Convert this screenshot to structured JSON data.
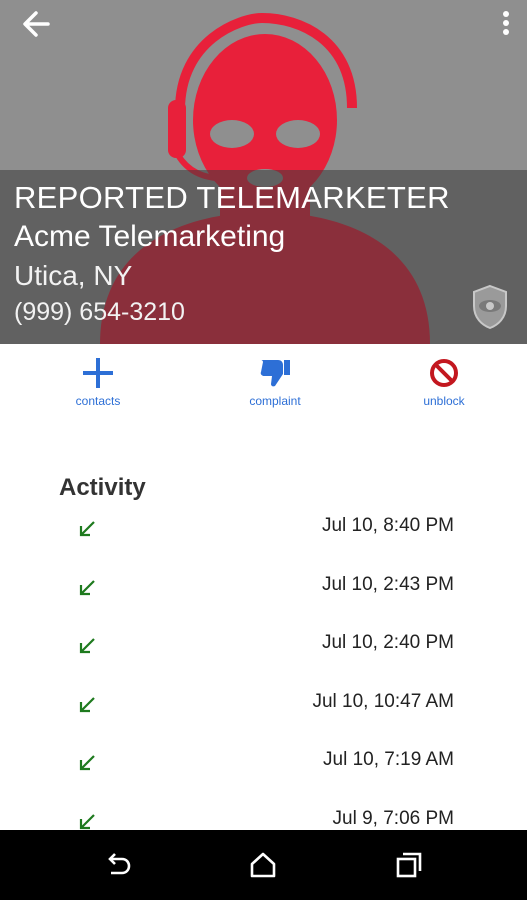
{
  "header": {
    "title": "REPORTED TELEMARKETER",
    "company": "Acme Telemarketing",
    "location": "Utica, NY",
    "phone": "(999) 654-3210"
  },
  "actions": [
    {
      "label": "contacts",
      "icon": "plus-icon"
    },
    {
      "label": "complaint",
      "icon": "thumbs-down-icon"
    },
    {
      "label": "unblock",
      "icon": "block-icon"
    }
  ],
  "activity": {
    "heading": "Activity",
    "items": [
      {
        "time": "Jul 10, 8:40 PM",
        "icon": "incoming-call-icon"
      },
      {
        "time": "Jul 10, 2:43 PM",
        "icon": "incoming-call-icon"
      },
      {
        "time": "Jul 10, 2:40 PM",
        "icon": "incoming-call-icon"
      },
      {
        "time": "Jul 10, 10:47 AM",
        "icon": "incoming-call-icon"
      },
      {
        "time": "Jul 10, 7:19 AM",
        "icon": "incoming-call-icon"
      },
      {
        "time": "Jul 9, 7:06 PM",
        "icon": "incoming-call-icon"
      }
    ]
  },
  "colors": {
    "accent_red": "#e8203a",
    "blue": "#2d6fd6",
    "green": "#1e7a1e",
    "hero_bg": "#8f8f8f"
  }
}
